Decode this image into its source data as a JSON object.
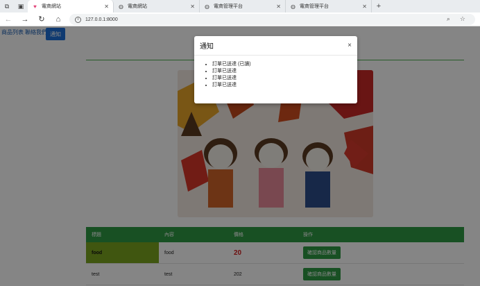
{
  "browser": {
    "tabs": [
      {
        "title": "電商網站",
        "icon": "heart-icon",
        "active": true
      },
      {
        "title": "電商網站",
        "icon": "globe-icon",
        "active": false
      },
      {
        "title": "電商管理平台",
        "icon": "globe-icon",
        "active": false
      },
      {
        "title": "電商管理平台",
        "icon": "globe-icon",
        "active": false
      }
    ],
    "url": "127.0.0.1:8000"
  },
  "page": {
    "nav_products": "商品列表",
    "nav_contact": "聯絡我們",
    "notify_button": "通知",
    "table": {
      "headers": [
        "標題",
        "內容",
        "價格",
        "操作"
      ],
      "rows": [
        {
          "title": "food",
          "content": "food",
          "price": "20",
          "action": "確認商品數量"
        },
        {
          "title": "test",
          "content": "test",
          "price": "202",
          "action": "確認商品數量"
        }
      ]
    }
  },
  "modal": {
    "title": "通知",
    "close": "×",
    "items": [
      "訂單已送達 (已讀)",
      "訂單已送達",
      "訂單已送達",
      "訂單已送達"
    ]
  },
  "colors": {
    "primary": "#1d6fd8",
    "table_header": "#2e9a44",
    "highlight": "#7ca61f",
    "price": "#d11e1e"
  }
}
